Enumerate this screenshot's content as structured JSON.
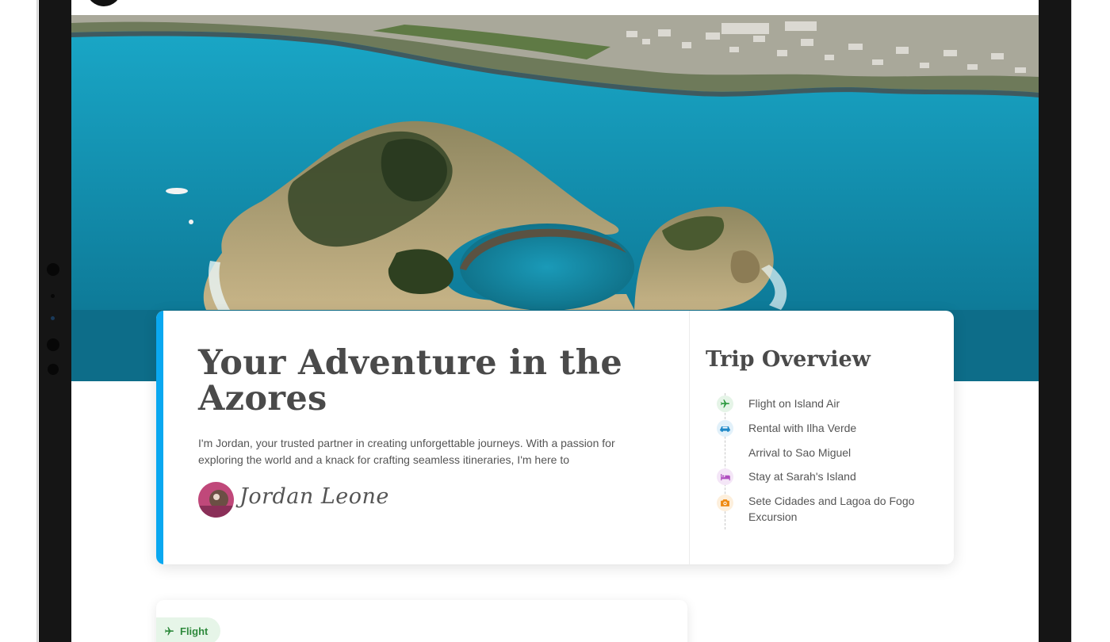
{
  "hero": {
    "title": "Your Adventure in the Azores",
    "intro": "I'm Jordan, your trusted partner in creating unforgettable journeys. With a passion for exploring the world and a knack for crafting seamless itineraries, I'm here to",
    "signature": "Jordan Leone"
  },
  "overview": {
    "title": "Trip Overview",
    "items": [
      {
        "label": "Flight on Island Air",
        "icon": "plane-icon",
        "color": "#2f9a41",
        "bg": "#e5f4e7"
      },
      {
        "label": "Rental with Ilha Verde",
        "icon": "car-icon",
        "color": "#1e88c8",
        "bg": "#e2f1fa"
      },
      {
        "label": "Arrival to Sao Miguel",
        "icon": "",
        "color": "",
        "bg": ""
      },
      {
        "label": "Stay at Sarah's Island",
        "icon": "bed-icon",
        "color": "#b04fc0",
        "bg": "#f4e6f7"
      },
      {
        "label": "Sete Cidades and Lagoa do Fogo Excursion",
        "icon": "camera-icon",
        "color": "#ee8a12",
        "bg": "#fdefdc"
      }
    ]
  },
  "section": {
    "flight_badge": "Flight"
  },
  "colors": {
    "accent": "#0aa8f0",
    "text": "#4a4a4a",
    "flight_green": "#2f8a3d"
  }
}
